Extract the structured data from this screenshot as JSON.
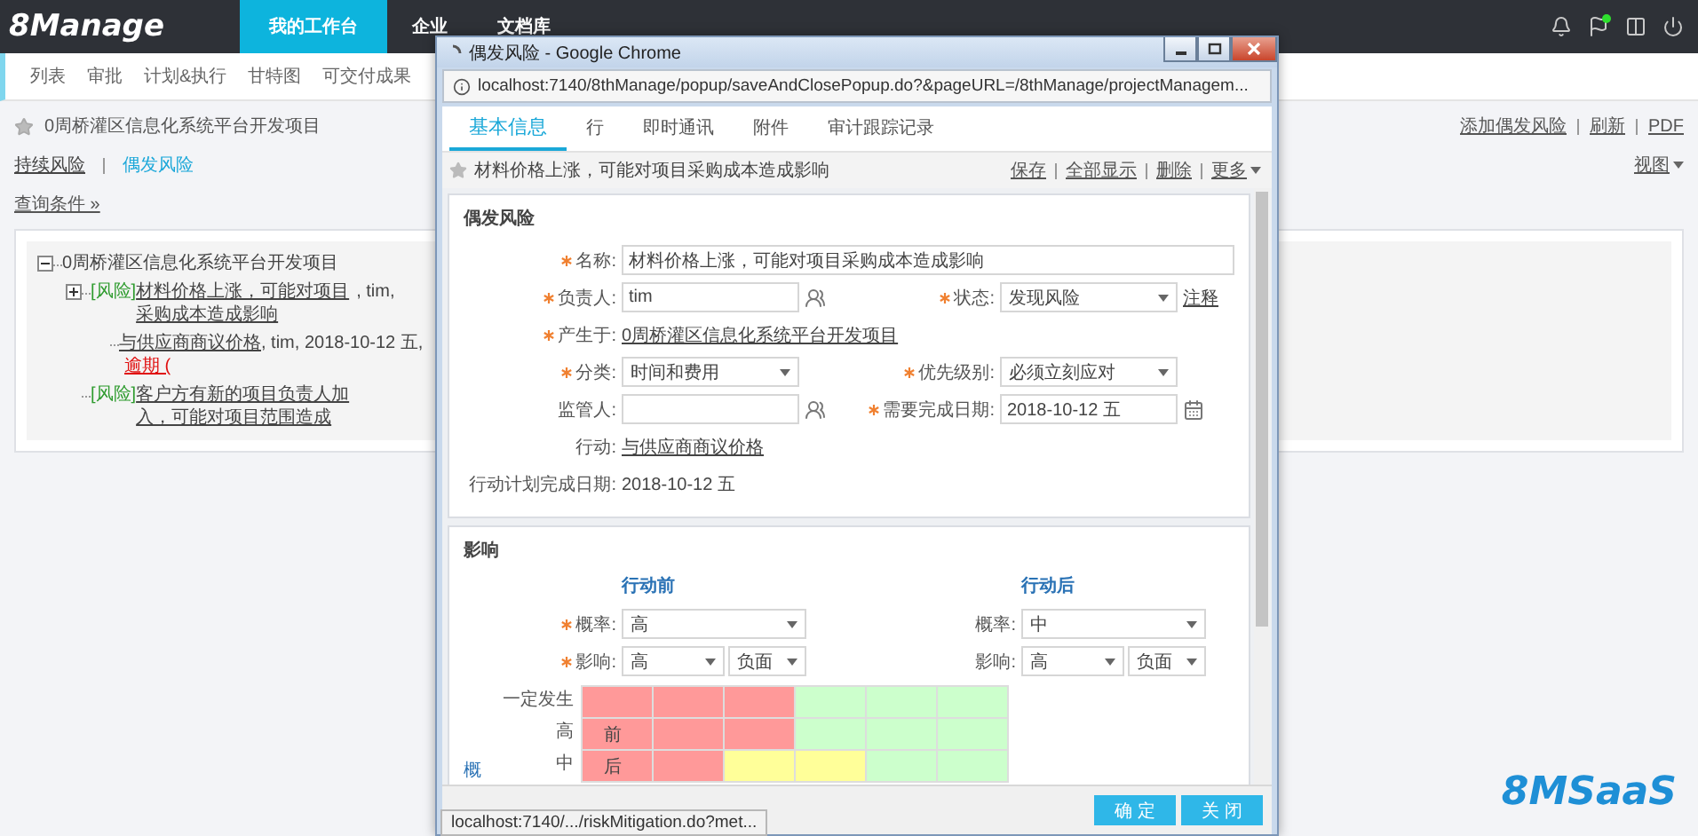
{
  "app": {
    "logo": "8Manage",
    "nav": [
      {
        "label": "我的工作台",
        "selected": true
      },
      {
        "label": "企业",
        "selected": false
      },
      {
        "label": "文档库",
        "selected": false
      }
    ],
    "subnav": [
      "列表",
      "审批",
      "计划&执行",
      "甘特图",
      "可交付成果"
    ]
  },
  "project": {
    "title": "0周桥灌区信息化系统平台开发项目",
    "actions": [
      "添加偶发风险",
      "刷新",
      "PDF"
    ],
    "view_menu": "视图"
  },
  "risk_tabs": [
    {
      "label": "持续风险",
      "selected": false
    },
    {
      "label": "偶发风险",
      "selected": true
    }
  ],
  "query_link": "查询条件 »",
  "tree": {
    "label": "0周桥灌区信息化系统平台开发项目",
    "expanded": true,
    "children": [
      {
        "tag": "[风险]",
        "label": "材料价格上涨，可能对项目采购成本造成影响",
        "details": ", tim,",
        "expanded": false,
        "children": [
          {
            "label": "与供应商商议价格",
            "details": ", tim, 2018-10-12 五,",
            "overdue": "逾期 ("
          }
        ]
      },
      {
        "tag": "[风险]",
        "label": "客户方有新的项目负责人加入，可能对项目范围造成"
      }
    ]
  },
  "brand_mark": "8MSaaS",
  "popup": {
    "title": "偶发风险 - Google Chrome",
    "url": "localhost:7140/8thManage/popup/saveAndClosePopup.do?&pageURL=/8thManage/projectManagem...",
    "tabs": [
      {
        "label": "基本信息",
        "selected": true
      },
      {
        "label": "行",
        "selected": false
      },
      {
        "label": "即时通讯",
        "selected": false
      },
      {
        "label": "附件",
        "selected": false
      },
      {
        "label": "审计跟踪记录",
        "selected": false
      }
    ],
    "heading": "材料价格上涨，可能对项目采购成本造成影响",
    "actions": [
      {
        "label": "保存",
        "kind": "link"
      },
      {
        "label": "全部显示",
        "kind": "link"
      },
      {
        "label": "删除",
        "kind": "link"
      },
      {
        "label": "更多",
        "kind": "menu"
      }
    ],
    "risk_section": {
      "title": "偶发风险",
      "rows": [
        [
          {
            "label": "名称:",
            "required": true,
            "kind": "text",
            "value": "材料价格上涨，可能对项目采购成本造成影响"
          }
        ],
        [
          {
            "label": "负责人:",
            "required": true,
            "kind": "person",
            "value": "tim"
          },
          {
            "label": "状态:",
            "required": true,
            "kind": "select",
            "value": "发现风险",
            "note": "注释"
          }
        ],
        [
          {
            "label": "产生于:",
            "required": true,
            "kind": "link",
            "value": "0周桥灌区信息化系统平台开发项目"
          }
        ],
        [
          {
            "label": "分类:",
            "required": true,
            "kind": "select",
            "value": "时间和费用"
          },
          {
            "label": "优先级别:",
            "required": true,
            "kind": "select",
            "value": "必须立刻应对"
          }
        ],
        [
          {
            "label": "监管人:",
            "required": false,
            "kind": "person"
          },
          {
            "label": "需要完成日期:",
            "required": true,
            "kind": "date",
            "value": "2018-10-12 五"
          }
        ],
        [
          {
            "label": "行动:",
            "required": false,
            "kind": "link",
            "value": "与供应商商议价格"
          }
        ],
        [
          {
            "label": "行动计划完成日期:",
            "required": false,
            "kind": "plain",
            "value": "2018-10-12 五"
          }
        ]
      ]
    },
    "impact_section": {
      "title": "影响",
      "phases": [
        {
          "heading": "行动前",
          "fields": [
            {
              "label": "概率:",
              "required": true,
              "selects": [
                "高"
              ]
            },
            {
              "label": "影响:",
              "required": true,
              "selects": [
                "高",
                "负面"
              ]
            }
          ]
        },
        {
          "heading": "行动后",
          "fields": [
            {
              "label": "概率:",
              "required": false,
              "selects": [
                "中"
              ]
            },
            {
              "label": "影响:",
              "required": false,
              "selects": [
                "高",
                "负面"
              ]
            }
          ]
        }
      ],
      "matrix": {
        "axis_label": "概",
        "rows": [
          {
            "label": "一定发生",
            "cells": [
              {
                "color": "#ff9999"
              },
              {
                "color": "#ff9999"
              },
              {
                "color": "#ff9999"
              },
              {
                "color": "#ccffcc"
              },
              {
                "color": "#ccffcc"
              },
              {
                "color": "#ccffcc"
              }
            ]
          },
          {
            "label": "高",
            "cells": [
              {
                "color": "#ff9999",
                "text": "前"
              },
              {
                "color": "#ff9999"
              },
              {
                "color": "#ff9999"
              },
              {
                "color": "#ccffcc"
              },
              {
                "color": "#ccffcc"
              },
              {
                "color": "#ccffcc"
              }
            ]
          },
          {
            "label": "中",
            "cells": [
              {
                "color": "#ff9999",
                "text": "后"
              },
              {
                "color": "#ff9999"
              },
              {
                "color": "#ffff99"
              },
              {
                "color": "#ffff99"
              },
              {
                "color": "#ccffcc"
              },
              {
                "color": "#ccffcc"
              }
            ]
          }
        ]
      }
    },
    "buttons": [
      "确 定",
      "关 闭"
    ],
    "status_url": "localhost:7140/.../riskMitigation.do?met..."
  }
}
